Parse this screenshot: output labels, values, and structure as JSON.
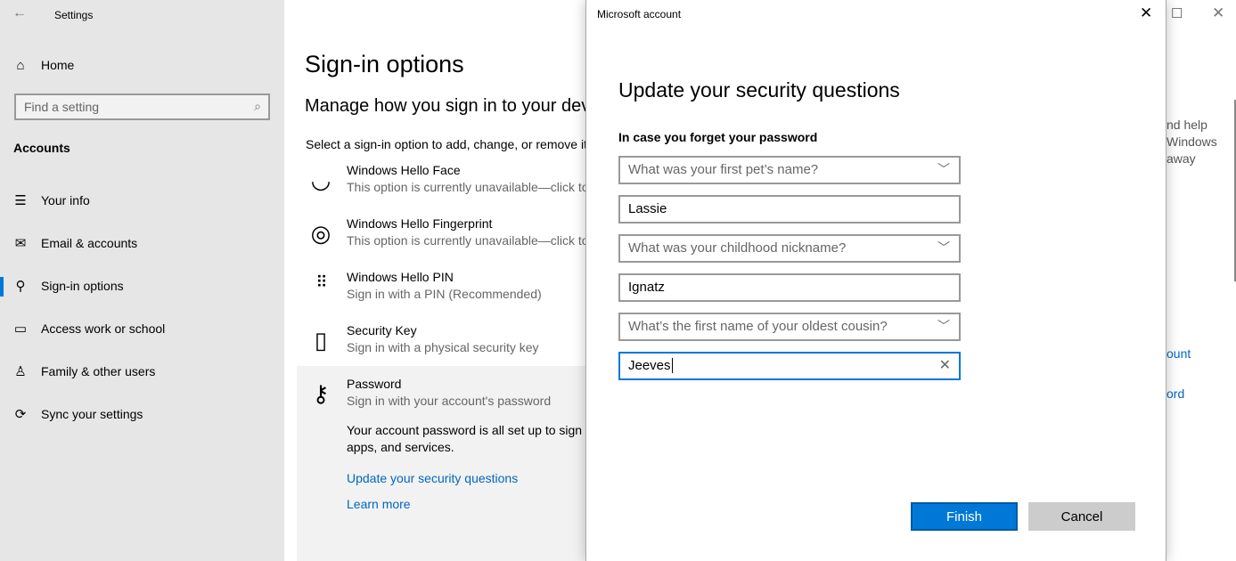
{
  "window": {
    "title": "Settings",
    "back_icon": "arrow-left-icon",
    "maximize_icon": "maximize-icon",
    "close_icon": "close-icon"
  },
  "sidebar": {
    "home": "Home",
    "search_placeholder": "Find a setting",
    "section": "Accounts",
    "items": [
      {
        "label": "Your info",
        "icon": "person-card-icon"
      },
      {
        "label": "Email & accounts",
        "icon": "mail-icon"
      },
      {
        "label": "Sign-in options",
        "icon": "key-icon",
        "selected": true
      },
      {
        "label": "Access work or school",
        "icon": "briefcase-icon"
      },
      {
        "label": "Family & other users",
        "icon": "person-add-icon"
      },
      {
        "label": "Sync your settings",
        "icon": "sync-icon"
      }
    ]
  },
  "main": {
    "title": "Sign-in options",
    "subtitle": "Manage how you sign in to your dev",
    "instruction": "Select a sign-in option to add, change, or remove it",
    "options": [
      {
        "title": "Windows Hello Face",
        "desc": "This option is currently unavailable—click to",
        "icon": "face-icon"
      },
      {
        "title": "Windows Hello Fingerprint",
        "desc": "This option is currently unavailable—click to",
        "icon": "fingerprint-icon"
      },
      {
        "title": "Windows Hello PIN",
        "desc": "Sign in with a PIN (Recommended)",
        "icon": "pin-keypad-icon"
      },
      {
        "title": "Security Key",
        "desc": "Sign in with a physical security key",
        "icon": "usb-key-icon"
      },
      {
        "title": "Password",
        "desc": "Sign in with your account's password",
        "icon": "key-icon"
      }
    ],
    "password_info_1": "Your account password is all set up to sign i",
    "password_info_2": "apps, and services.",
    "update_link": "Update your security questions",
    "learn_more": "Learn more",
    "right_text": [
      "nd help",
      "Windows",
      "away"
    ],
    "right_links": [
      "ount",
      "ord"
    ]
  },
  "dialog": {
    "title": "Microsoft account",
    "heading": "Update your security questions",
    "label": "In case you forget your password",
    "fields": [
      {
        "type": "select",
        "value": "What was your first pet’s name?"
      },
      {
        "type": "text",
        "value": "Lassie"
      },
      {
        "type": "select",
        "value": "What was your childhood nickname?"
      },
      {
        "type": "text",
        "value": "Ignatz"
      },
      {
        "type": "select",
        "value": "What’s the first name of your oldest cousin?"
      },
      {
        "type": "text",
        "value": "Jeeves",
        "focused": true
      }
    ],
    "finish": "Finish",
    "cancel": "Cancel"
  },
  "colors": {
    "accent": "#0078d7",
    "link": "#0067c0",
    "sidebar_bg": "#e6e6e6"
  }
}
